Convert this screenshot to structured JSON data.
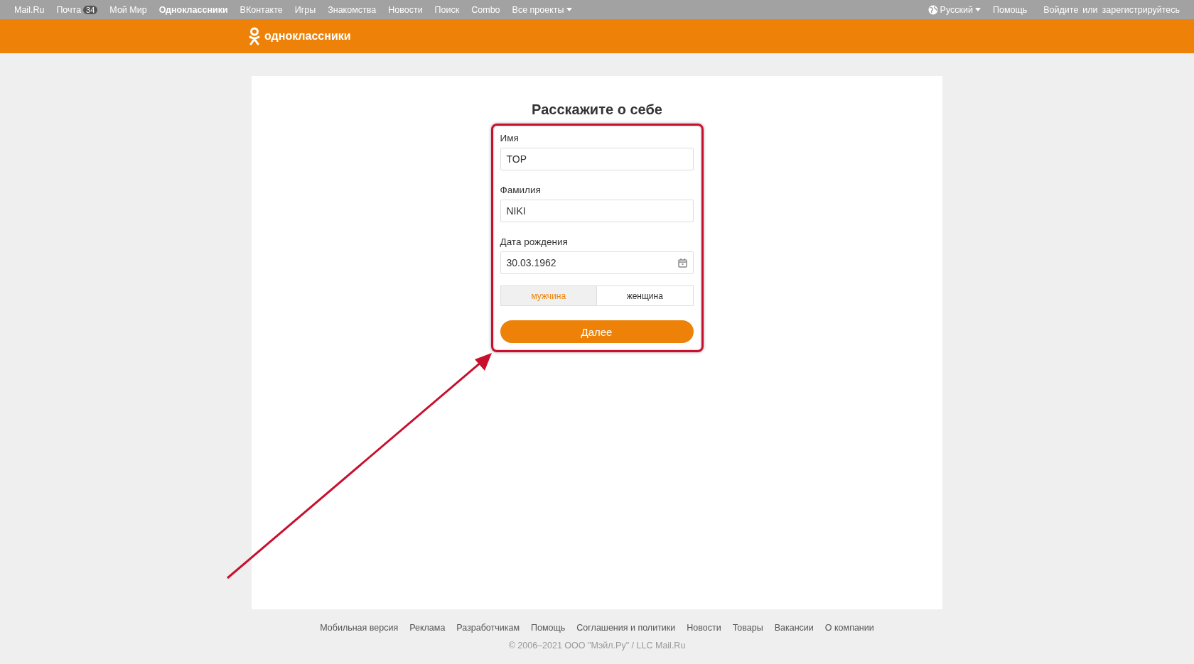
{
  "top_nav": {
    "links": [
      {
        "label": "Mail.Ru",
        "selected": false
      },
      {
        "label": "Почта",
        "badge": "34",
        "selected": false
      },
      {
        "label": "Мой Мир",
        "selected": false
      },
      {
        "label": "Одноклассники",
        "selected": true
      },
      {
        "label": "ВКонтакте",
        "selected": false
      },
      {
        "label": "Игры",
        "selected": false
      },
      {
        "label": "Знакомства",
        "selected": false
      },
      {
        "label": "Новости",
        "selected": false
      },
      {
        "label": "Поиск",
        "selected": false
      },
      {
        "label": "Combo",
        "selected": false
      },
      {
        "label": "Все проекты",
        "selected": false,
        "dropdown": true
      }
    ],
    "language": "Русский",
    "help": "Помощь",
    "login": "Войдите",
    "or": "или",
    "register": "зарегистрируйтесь"
  },
  "header": {
    "logo_text": "одноклассники"
  },
  "form": {
    "title": "Расскажите о себе",
    "fields": [
      {
        "label": "Имя",
        "value": "TOP",
        "kind": "text"
      },
      {
        "label": "Фамилия",
        "value": "NIKI",
        "kind": "text"
      },
      {
        "label": "Дата рождения",
        "value": "30.03.1962",
        "kind": "date"
      }
    ],
    "gender": [
      {
        "label": "мужчина",
        "selected": true
      },
      {
        "label": "женщина",
        "selected": false
      }
    ],
    "submit": "Далее"
  },
  "footer": {
    "links": [
      "Мобильная версия",
      "Реклама",
      "Разработчикам",
      "Помощь",
      "Соглашения и политики",
      "Новости",
      "Товары",
      "Вакансии",
      "О компании"
    ],
    "copyright": "© 2006–2021 ООО \"Мэйл.Ру\" / LLC Mail.Ru"
  }
}
